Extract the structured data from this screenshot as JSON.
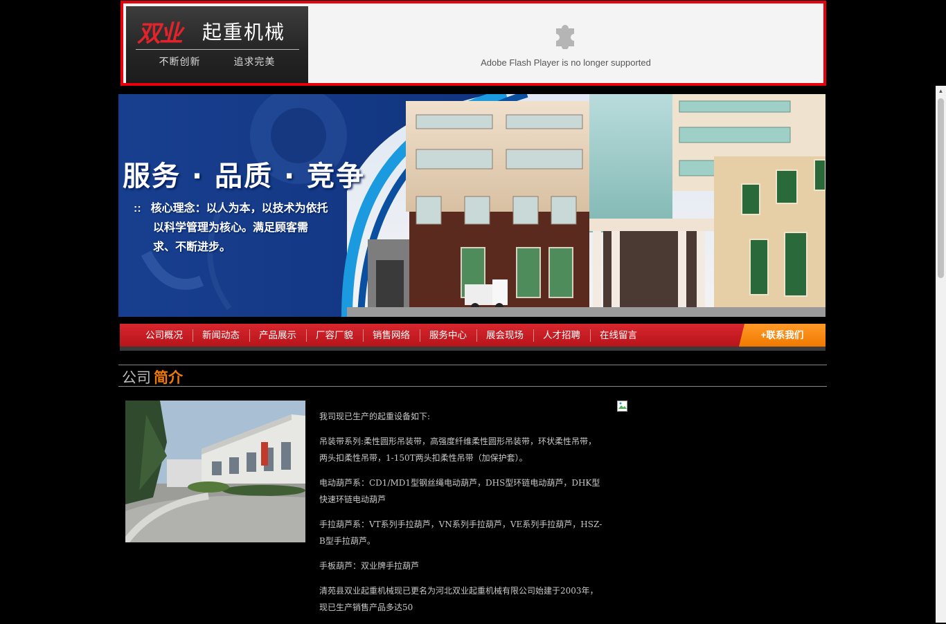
{
  "header": {
    "logo": {
      "brand": "双业",
      "name": "起重机械",
      "slogan": [
        "不断创新",
        "追求完美"
      ]
    },
    "flash": {
      "icon": "puzzle-plugin-icon",
      "message": "Adobe Flash Player is no longer supported"
    }
  },
  "banner": {
    "slogan": "服务 · 品质 · 竞争",
    "bullet": "::",
    "text_lines": [
      "核心理念：以人为本，以技术为依托",
      "以科学管理为核心。满足顾客需",
      "求、不断进步。"
    ]
  },
  "nav": {
    "items": [
      "公司概况",
      "新闻动态",
      "产品展示",
      "厂容厂貌",
      "销售网络",
      "服务中心",
      "展会现场",
      "人才招聘",
      "在线留言"
    ],
    "contact": "+联系我们"
  },
  "section": {
    "title_part1": "公司",
    "title_part2": "简介",
    "paragraphs": [
      "我司现已生产的起重设备如下:",
      "吊装带系列:柔性圆形吊装带，高强度纤维柔性圆形吊装带，环状柔性吊带，两头扣柔性吊带，1-150T两头扣柔性吊带（加保护套）。",
      "电动葫芦系：CD1/MD1型钢丝绳电动葫芦，DHS型环链电动葫芦，DHK型快速环链电动葫芦",
      "手拉葫芦系：VT系列手拉葫芦，VN系列手拉葫芦，VE系列手拉葫芦，HSZ-B型手拉葫芦。",
      "手板葫芦：双业牌手拉葫芦",
      "清苑县双业起重机械现已更名为河北双业起重机械有限公司始建于2003年，现已生产销售产品多达50"
    ]
  },
  "colors": {
    "header_border": "#e8000d",
    "nav_red": "#c81d24",
    "nav_contact_orange": "#f7870f",
    "section_accent": "#f27b00",
    "background": "#000000"
  }
}
